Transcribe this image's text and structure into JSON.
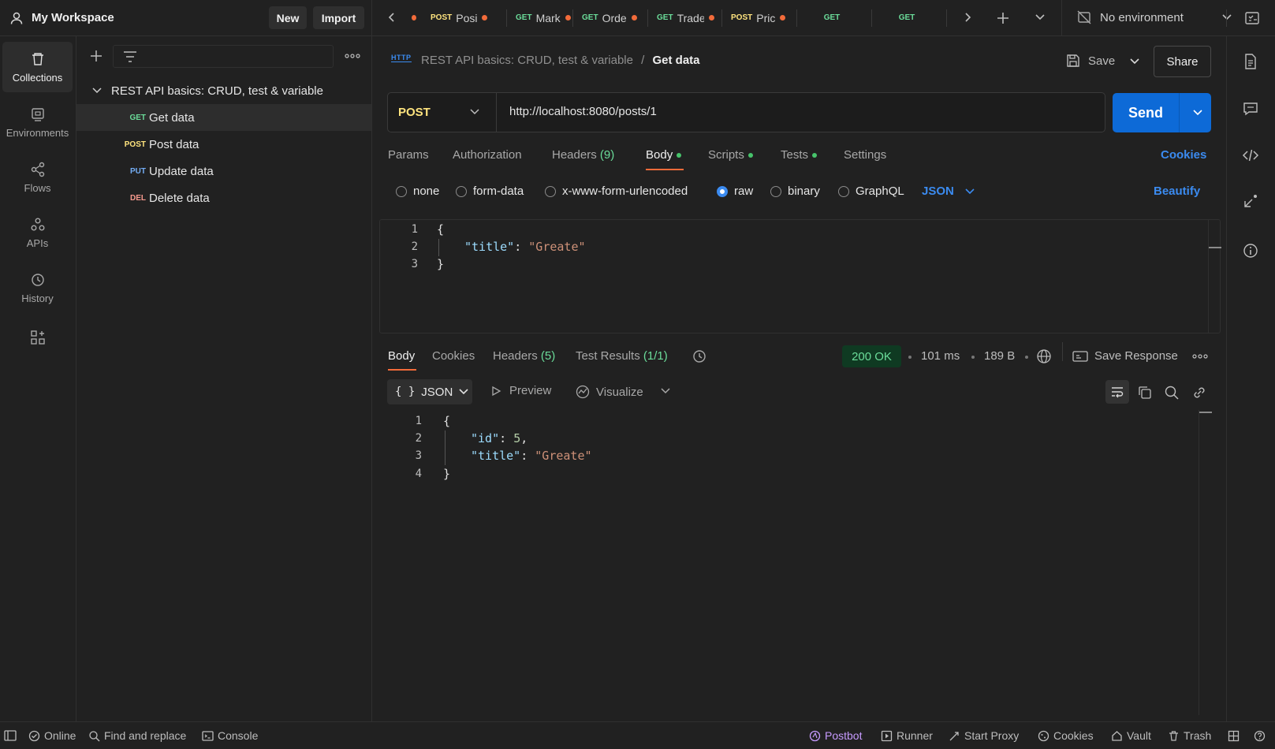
{
  "workspace": {
    "title": "My Workspace",
    "new_label": "New",
    "import_label": "Import"
  },
  "tabs": [
    {
      "method": "POST",
      "name": "Posi",
      "unsaved": true
    },
    {
      "method": "GET",
      "name": "Mark",
      "unsaved": true
    },
    {
      "method": "GET",
      "name": "Orde",
      "unsaved": true
    },
    {
      "method": "GET",
      "name": "Trade",
      "unsaved": true
    },
    {
      "method": "POST",
      "name": "Pric",
      "unsaved": true
    },
    {
      "method": "GET",
      "name": "",
      "unsaved": false
    },
    {
      "method": "GET",
      "name": "",
      "unsaved": false
    }
  ],
  "environment": {
    "label": "No environment"
  },
  "leftnav": [
    {
      "label": "Collections",
      "icon": "trash-can-icon"
    },
    {
      "label": "Environments",
      "icon": "environment-icon"
    },
    {
      "label": "Flows",
      "icon": "flows-icon"
    },
    {
      "label": "APIs",
      "icon": "apis-icon"
    },
    {
      "label": "History",
      "icon": "history-icon"
    }
  ],
  "collection": {
    "name": "REST API basics: CRUD, test & variable",
    "items": [
      {
        "method": "GET",
        "label": "Get data"
      },
      {
        "method": "POST",
        "label": "Post data"
      },
      {
        "method": "PUT",
        "label": "Update data"
      },
      {
        "method": "DEL",
        "label": "Delete data"
      }
    ]
  },
  "request": {
    "icon_text": "HTTP",
    "breadcrumb_parent": "REST API basics: CRUD, test & variable",
    "breadcrumb_sep": "/",
    "breadcrumb_current": "Get data",
    "save_label": "Save",
    "share_label": "Share",
    "method": "POST",
    "url": "http://localhost:8080/posts/1",
    "send_label": "Send",
    "tabs": {
      "params": "Params",
      "authorization": "Authorization",
      "headers": "Headers",
      "headers_count": "(9)",
      "body": "Body",
      "scripts": "Scripts",
      "tests": "Tests",
      "settings": "Settings"
    },
    "cookies_label": "Cookies",
    "body_types": {
      "none": "none",
      "form_data": "form-data",
      "urlencoded": "x-www-form-urlencoded",
      "raw": "raw",
      "binary": "binary",
      "graphql": "GraphQL"
    },
    "selected_body_type": "raw",
    "format": "JSON",
    "beautify_label": "Beautify",
    "body_lines": [
      {
        "num": "1",
        "text": "{"
      },
      {
        "num": "2",
        "key": "\"title\"",
        "colon": ": ",
        "value": "\"Greate\""
      },
      {
        "num": "3",
        "text": "}"
      }
    ]
  },
  "response": {
    "tabs": {
      "body": "Body",
      "cookies": "Cookies",
      "headers": "Headers",
      "headers_count": "(5)",
      "test_results": "Test Results",
      "test_count": "(1/1)"
    },
    "status": "200 OK",
    "time": "101 ms",
    "size": "189 B",
    "save_response_label": "Save Response",
    "format_label": "JSON",
    "format_prefix": "{ }",
    "preview_label": "Preview",
    "visualize_label": "Visualize",
    "body_lines": [
      {
        "num": "1",
        "text": "{"
      },
      {
        "num": "2",
        "key": "\"id\"",
        "colon": ": ",
        "value": "5",
        "trail": ","
      },
      {
        "num": "3",
        "key": "\"title\"",
        "colon": ": ",
        "value": "\"Greate\""
      },
      {
        "num": "4",
        "text": "}"
      }
    ]
  },
  "footer": {
    "online": "Online",
    "find_replace": "Find and replace",
    "console": "Console",
    "postbot": "Postbot",
    "runner": "Runner",
    "start_proxy": "Start Proxy",
    "cookies": "Cookies",
    "vault": "Vault",
    "trash": "Trash"
  },
  "colors": {
    "accent": "#0d6ad7",
    "link": "#3b8bf0",
    "get": "#6bdd9a",
    "post": "#ffe47e",
    "put": "#74aef6",
    "delete": "#f79a8e",
    "unsaved_dot": "#f26b3a",
    "postbot": "#c79bff"
  }
}
